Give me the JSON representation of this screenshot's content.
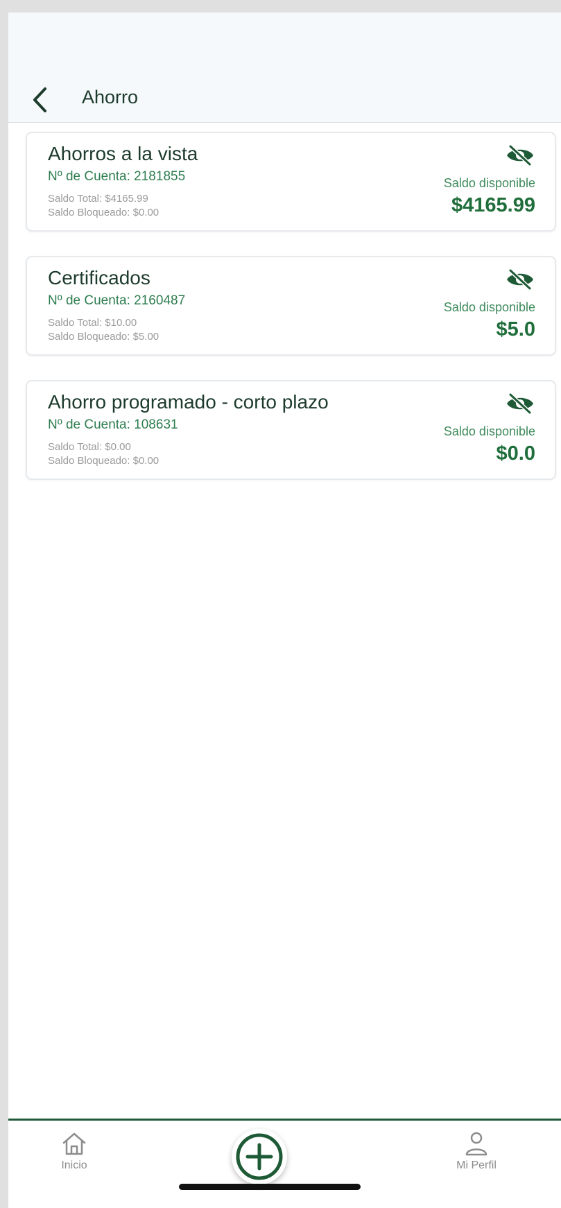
{
  "header": {
    "title": "Ahorro",
    "back_icon": "chevron-left-icon"
  },
  "accounts": [
    {
      "name": "Ahorros a la vista",
      "account_number": "Nº de Cuenta: 2181855",
      "total": "Saldo Total: $4165.99",
      "blocked": "Saldo Bloqueado: $0.00",
      "available_label": "Saldo disponible",
      "available": "$4165.99"
    },
    {
      "name": "Certificados",
      "account_number": "Nº de Cuenta: 2160487",
      "total": "Saldo Total: $10.00",
      "blocked": "Saldo Bloqueado: $5.00",
      "available_label": "Saldo disponible",
      "available": "$5.0"
    },
    {
      "name": "Ahorro programado - corto plazo",
      "account_number": "Nº de Cuenta: 108631",
      "total": "Saldo Total: $0.00",
      "blocked": "Saldo Bloqueado: $0.00",
      "available_label": "Saldo disponible",
      "available": "$0.0"
    }
  ],
  "bottom_nav": {
    "home_label": "Inicio",
    "add_icon": "plus-circle-icon",
    "profile_label": "Mi Perfil"
  },
  "colors": {
    "primary_green": "#1f6e3b",
    "dark_green": "#1d3b2c",
    "header_bg": "#f5f9fc"
  }
}
